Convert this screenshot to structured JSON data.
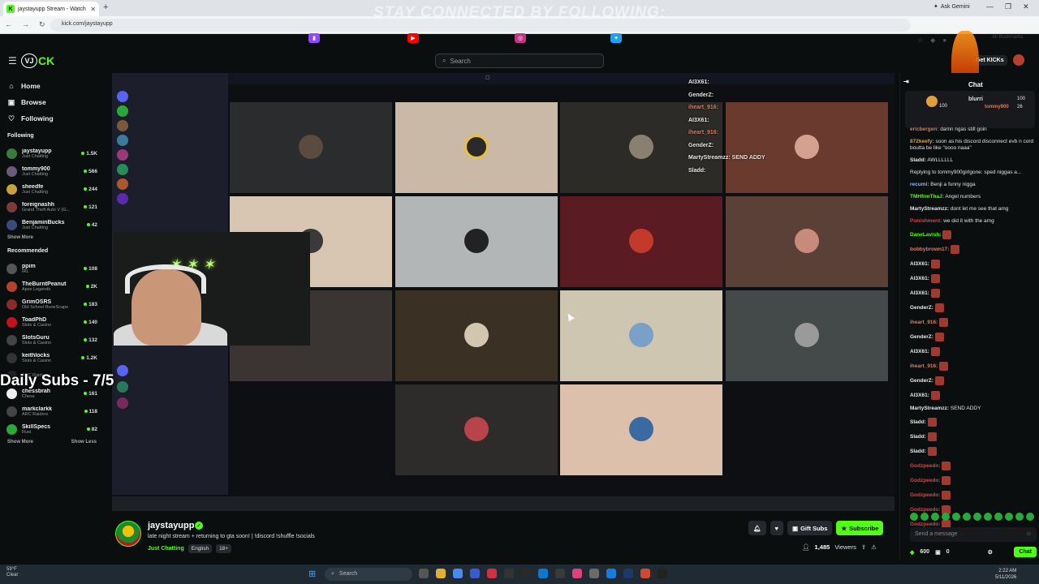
{
  "browser": {
    "tab_title": "jaystayupp Stream - Watch",
    "url": "kick.com/jaystayupp",
    "ask_gemini": "Ask Gemini",
    "all_bookmarks": "All Bookmarks"
  },
  "overlay": {
    "banner": "STAY CONNECTED BY FOLLOWING:",
    "daily_subs": "Daily Subs - 7/5"
  },
  "header": {
    "search_placeholder": "Search",
    "get_kicks": "Get KICKs"
  },
  "sidebar": {
    "nav": [
      {
        "label": "Home",
        "icon": "home-icon"
      },
      {
        "label": "Browse",
        "icon": "compass-icon"
      },
      {
        "label": "Following",
        "icon": "heart-icon"
      }
    ],
    "following_title": "Following",
    "following": [
      {
        "name": "jaystayupp",
        "category": "Just Chatting",
        "viewers": "1.5K",
        "color": "#3a7a3a"
      },
      {
        "name": "tommy900",
        "category": "Just Chatting",
        "viewers": "566",
        "color": "#6b5a7a"
      },
      {
        "name": "sheedfe",
        "category": "Just Chatting",
        "viewers": "244",
        "color": "#c6a23a"
      },
      {
        "name": "foreignashh",
        "category": "Grand Theft Auto V (G...",
        "viewers": "121",
        "color": "#7a3a3a"
      },
      {
        "name": "BenjaminBucks",
        "category": "Just Chatting",
        "viewers": "42",
        "color": "#3a4a7a"
      }
    ],
    "show_more": "Show More",
    "recommended_title": "Recommended",
    "recommended": [
      {
        "name": "ppim",
        "category": "IRL",
        "viewers": "108",
        "color": "#555"
      },
      {
        "name": "TheBurntPeanut",
        "category": "Apex Legends",
        "viewers": "2K",
        "color": "#b5412e"
      },
      {
        "name": "GrimOSRS",
        "category": "Old School RuneScape",
        "viewers": "183",
        "color": "#8a2a2a"
      },
      {
        "name": "ToadPhD",
        "category": "Slots & Casino",
        "viewers": "140",
        "color": "#c4121a"
      },
      {
        "name": "SlotsGuru",
        "category": "Slots & Casino",
        "viewers": "132",
        "color": "#444"
      },
      {
        "name": "keithlocks",
        "category": "Slots & Casino",
        "viewers": "1.2K",
        "color": "#333"
      },
      {
        "name": "",
        "category": "ARC Raiders",
        "viewers": "",
        "color": "#222"
      },
      {
        "name": "chessbrah",
        "category": "Chess",
        "viewers": "161",
        "color": "#eee"
      },
      {
        "name": "markclarkk",
        "category": "ARC Raiders",
        "viewers": "118",
        "color": "#444"
      },
      {
        "name": "SkillSpecs",
        "category": "Rust",
        "viewers": "82",
        "color": "#2ba83b"
      }
    ],
    "show_more_2": "Show More",
    "show_less": "Show Less"
  },
  "stream_overlay_chat": [
    {
      "user": "AI3X61:",
      "color": "#e6e6e6"
    },
    {
      "user": "GenderZ:",
      "color": "#e6e6e6"
    },
    {
      "user": "iheart_916:",
      "color": "#e07a5a"
    },
    {
      "user": "AI3X61:",
      "color": "#e6e6e6"
    },
    {
      "user": "iheart_916:",
      "color": "#e07a5a"
    },
    {
      "user": "GenderZ:",
      "color": "#e6e6e6"
    },
    {
      "user": "MartyStreamzz: SEND ADDY",
      "color": "#e6e6e6"
    },
    {
      "user": "Sladd:",
      "color": "#e6e6e6"
    }
  ],
  "stream_info": {
    "streamer": "jaystayupp",
    "title": "late night stream + returning to gta soon! | !discord !shuffle !socials",
    "category": "Just Chatting",
    "tags": [
      "English",
      "18+"
    ],
    "gift_subs": "Gift Subs",
    "subscribe": "Subscribe",
    "viewers": "1,485",
    "viewers_label": "Viewers"
  },
  "chat": {
    "title": "Chat",
    "pinned_user": "blurri",
    "pinned_stat1": "100",
    "pinned_stat2": "100",
    "pinned_user2": "tommy900",
    "pinned_count": "26",
    "messages": [
      {
        "user": "ericbergen:",
        "text": "damn ngas still goin",
        "color": "#e07a5a"
      },
      {
        "user": "872keefy:",
        "text": "soon as his discord disconnect evb n cord boutta be like \"oooo naaa\"",
        "color": "#e0a03a"
      },
      {
        "user": "Sladd:",
        "text": "AWLLLLLL",
        "color": "#e6e6e6"
      },
      {
        "user": "",
        "text": "Replying to tommy900girlgone: sped niggas a...",
        "color": "#888"
      },
      {
        "user": "recumi:",
        "text": "Benji a funny nigga",
        "color": "#8ab4ff"
      },
      {
        "user": "TMHfrmThaJ:",
        "text": "Angel numbers",
        "color": "#53fc18"
      },
      {
        "user": "MartyStreamzz:",
        "text": "dont let me see that amg",
        "color": "#e6e6e6"
      },
      {
        "user": "Punishment:",
        "text": "we did it with the amg",
        "color": "#e04040"
      },
      {
        "user": "DaneLavish:",
        "text": "",
        "color": "#53fc18"
      },
      {
        "user": "bobbybrown17:",
        "text": "",
        "color": "#e07a5a"
      },
      {
        "user": "AI3X61:",
        "text": "",
        "color": "#e6e6e6"
      },
      {
        "user": "AI3X61:",
        "text": "",
        "color": "#e6e6e6"
      },
      {
        "user": "AI3X61:",
        "text": "",
        "color": "#e6e6e6"
      },
      {
        "user": "GenderZ:",
        "text": "",
        "color": "#e6e6e6"
      },
      {
        "user": "iheart_916:",
        "text": "",
        "color": "#e07a5a"
      },
      {
        "user": "GenderZ:",
        "text": "",
        "color": "#e6e6e6"
      },
      {
        "user": "AI3X61:",
        "text": "",
        "color": "#e6e6e6"
      },
      {
        "user": "iheart_916:",
        "text": "",
        "color": "#e07a5a"
      },
      {
        "user": "GenderZ:",
        "text": "",
        "color": "#e6e6e6"
      },
      {
        "user": "AI3X61:",
        "text": "",
        "color": "#e6e6e6"
      },
      {
        "user": "MartyStreamzz:",
        "text": "SEND ADDY",
        "color": "#e6e6e6"
      },
      {
        "user": "Sladd:",
        "text": "",
        "color": "#e6e6e6"
      },
      {
        "user": "Sladd:",
        "text": "",
        "color": "#e6e6e6"
      },
      {
        "user": "Sladd:",
        "text": "",
        "color": "#e6e6e6"
      },
      {
        "user": "Godzpeedo:",
        "text": "",
        "color": "#e04040"
      },
      {
        "user": "Godzpeedo:",
        "text": "",
        "color": "#e04040"
      },
      {
        "user": "Godzpeedo:",
        "text": "",
        "color": "#e04040"
      },
      {
        "user": "Godzpeedo:",
        "text": "",
        "color": "#e04040"
      },
      {
        "user": "Godzpeedo:",
        "text": "",
        "color": "#e04040"
      }
    ],
    "input_placeholder": "Send a message",
    "kicks": "600",
    "points": "0",
    "chat_button": "Chat"
  },
  "windows": {
    "weather_temp": "59°F",
    "weather_desc": "Clear",
    "search": "Search",
    "time": "2:22 AM",
    "date": "5/11/2026"
  }
}
